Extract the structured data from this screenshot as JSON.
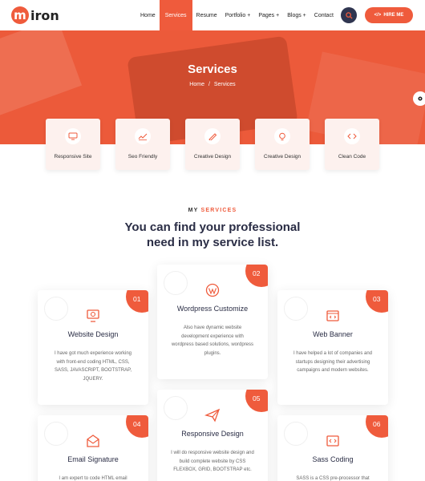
{
  "header": {
    "logo_letter": "m",
    "logo_text": "iron",
    "nav": [
      "Home",
      "Services",
      "Resume",
      "Portfolio +",
      "Pages +",
      "Blogs +",
      "Contact"
    ],
    "hire_label": "HIRE ME"
  },
  "hero": {
    "title": "Services",
    "breadcrumb": {
      "home": "Home",
      "sep": "/",
      "current": "Services"
    }
  },
  "service_boxes": [
    {
      "label": "Responsive Site",
      "icon": "responsive-icon"
    },
    {
      "label": "Seo Friendly",
      "icon": "seo-icon"
    },
    {
      "label": "Creative Design",
      "icon": "pen-icon"
    },
    {
      "label": "Creative Design",
      "icon": "lightbulb-icon"
    },
    {
      "label": "Clean Code",
      "icon": "code-icon"
    }
  ],
  "section": {
    "eyebrow_a": "MY ",
    "eyebrow_b": "SERVICES",
    "heading_l1": "You can find your professional",
    "heading_l2": "need in my service list."
  },
  "cards": [
    {
      "num": "01",
      "title": "Website Design",
      "desc": "I have got much experience working with front-end coding HTML, CSS, SASS, JAVASCRIPT, BOOTSTRAP, JQUERY.",
      "icon": "monitor-icon"
    },
    {
      "num": "02",
      "title": "Wordpress Customize",
      "desc": "Also have dynamic website development experience with wordpress based solutions, wordpress plugins.",
      "icon": "wordpress-icon"
    },
    {
      "num": "03",
      "title": "Web Banner",
      "desc": "I have helped a lot of companies and startups designing their advertising campaigns and modern websites.",
      "icon": "banner-icon"
    },
    {
      "num": "04",
      "title": "Email Signature",
      "desc": "I am expert to code HTML email",
      "icon": "email-icon"
    },
    {
      "num": "05",
      "title": "Responsive Design",
      "desc": "I will do responsive website design and build complete website by CSS FLEXBOX, GRID, BOOTSTRAP etc.",
      "icon": "paper-plane-icon"
    },
    {
      "num": "06",
      "title": "Sass Coding",
      "desc": "SASS is a CSS pre-processor that",
      "icon": "code-window-icon"
    }
  ],
  "colors": {
    "accent": "#ef5b3c",
    "dark": "#2a2d45",
    "search_bg": "#2f3550"
  }
}
